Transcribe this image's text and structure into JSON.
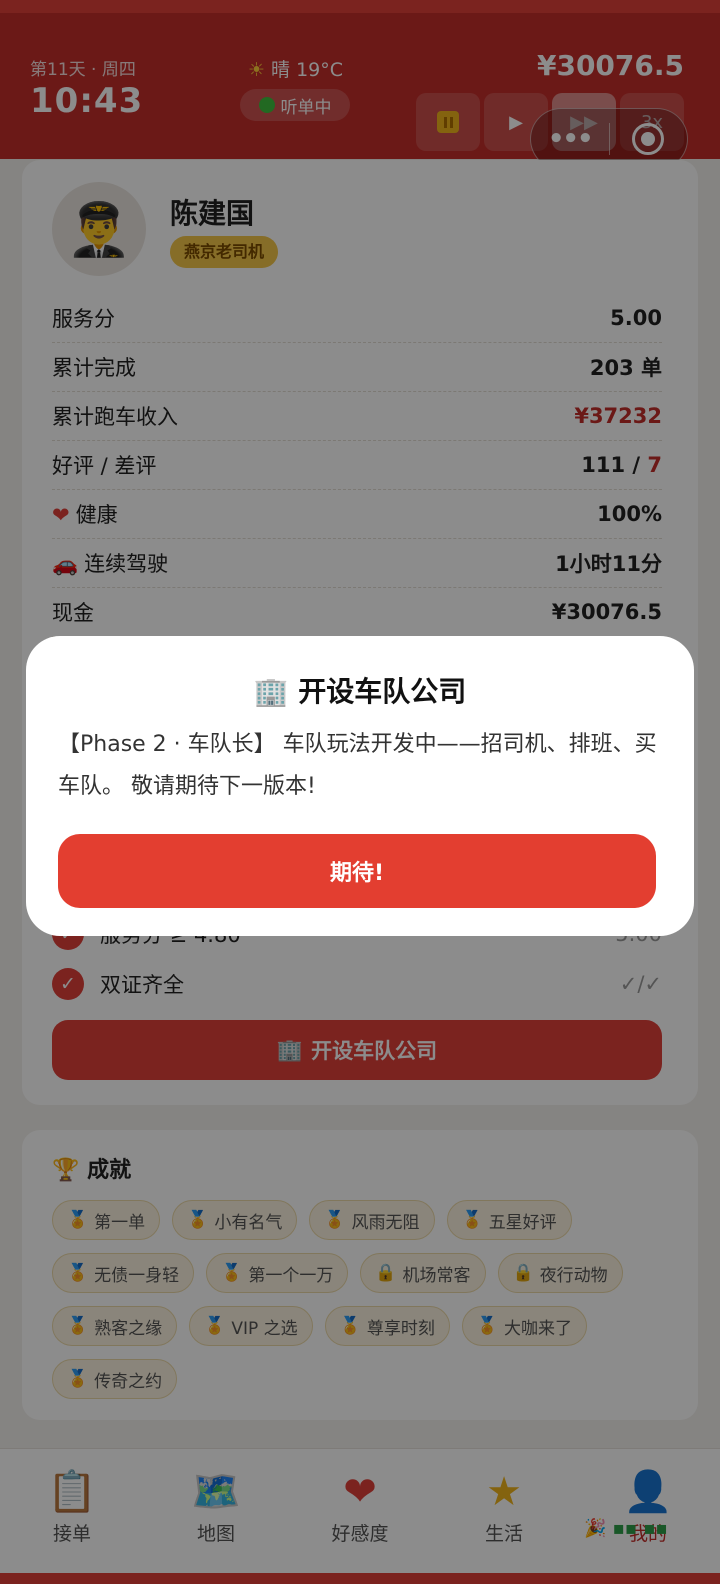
{
  "header": {
    "day_label": "第11天 · 周四",
    "time": "10:43",
    "weather": "晴 19°C",
    "weather_icon": "sun-icon",
    "status": "听单中",
    "balance": "¥30076.5",
    "speed_buttons": [
      "▶",
      "▶▶",
      "3x"
    ]
  },
  "profile": {
    "avatar_icon": "pilot-avatar-icon",
    "name": "陈建国",
    "badge": "燕京老司机"
  },
  "stats": [
    {
      "label": "服务分",
      "value": "5.00"
    },
    {
      "label": "累计完成",
      "value": "203 单"
    },
    {
      "label": "累计跑车收入",
      "value": "¥37232"
    },
    {
      "label": "好评 / 差评",
      "good": "111",
      "sep": " / ",
      "bad": "7"
    },
    {
      "icon": "heart-icon",
      "label": "健康",
      "value": "100%"
    },
    {
      "icon": "car-icon",
      "label": "连续驾驶",
      "value": "1小时11分"
    },
    {
      "label": "现金",
      "value": "¥30076.5"
    }
  ],
  "requirements": [
    {
      "label": "服务分 ≥ 4.80",
      "value": "5.00"
    },
    {
      "label": "双证齐全",
      "value": "✓/✓"
    }
  ],
  "fleet_button": "开设车队公司",
  "achievements": {
    "title": "成就",
    "items": [
      {
        "label": "第一单",
        "locked": false
      },
      {
        "label": "小有名气",
        "locked": false
      },
      {
        "label": "风雨无阻",
        "locked": false
      },
      {
        "label": "五星好评",
        "locked": false
      },
      {
        "label": "无债一身轻",
        "locked": false
      },
      {
        "label": "第一个一万",
        "locked": false
      },
      {
        "label": "机场常客",
        "locked": true
      },
      {
        "label": "夜行动物",
        "locked": true
      },
      {
        "label": "熟客之缘",
        "locked": false
      },
      {
        "label": "VIP 之选",
        "locked": false
      },
      {
        "label": "尊享时刻",
        "locked": false
      },
      {
        "label": "大咖来了",
        "locked": false
      },
      {
        "label": "传奇之约",
        "locked": false
      }
    ]
  },
  "tabs": [
    {
      "label": "接单",
      "icon": "clipboard-icon"
    },
    {
      "label": "地图",
      "icon": "map-icon"
    },
    {
      "label": "好感度",
      "icon": "heart-icon"
    },
    {
      "label": "生活",
      "icon": "star-icon"
    },
    {
      "label": "我的",
      "icon": "user-icon",
      "active": true
    }
  ],
  "dialog": {
    "title": "开设车队公司",
    "icon": "office-building-icon",
    "message": "【Phase 2 · 车队长】 车队玩法开发中——招司机、排班、买车队。 敬请期待下一版本!",
    "button": "期待!"
  },
  "colors": {
    "primary": "#e0403a",
    "header": "#c42e2a",
    "badge": "#f5c64a"
  }
}
